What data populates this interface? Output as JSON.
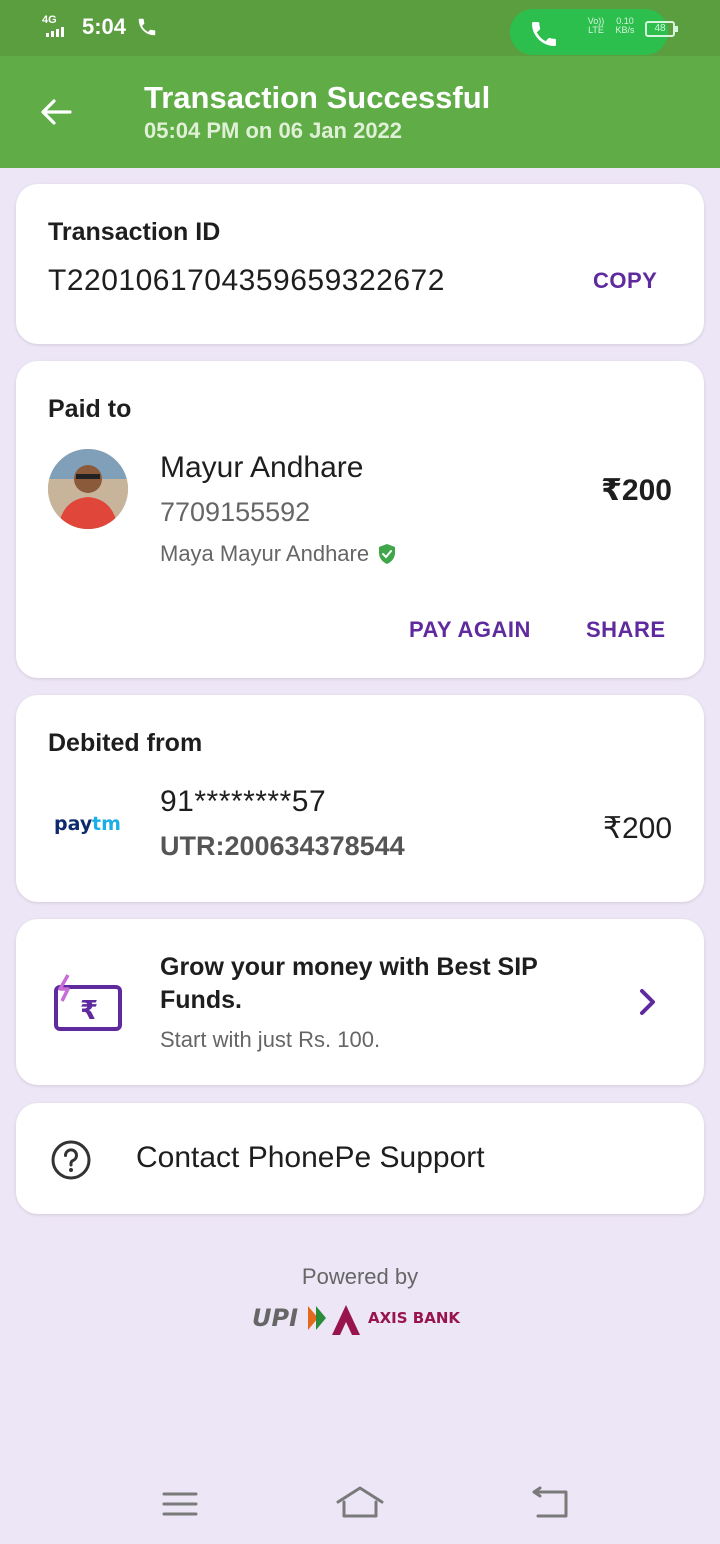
{
  "status_bar": {
    "network": "4G",
    "time": "5:04",
    "call_net": "Vo)) LTE",
    "speed": "0.10 KB/s",
    "battery": "48"
  },
  "header": {
    "title": "Transaction Successful",
    "subtitle": "05:04 PM on 06 Jan 2022",
    "background": "#60ad47"
  },
  "transaction": {
    "label": "Transaction ID",
    "id": "T2201061704359659322672",
    "copy_label": "COPY"
  },
  "paid_to": {
    "label": "Paid to",
    "name": "Mayur Andhare",
    "phone": "7709155592",
    "bank_name": "Maya Mayur Andhare",
    "amount": "₹200",
    "pay_again_label": "PAY AGAIN",
    "share_label": "SHARE"
  },
  "debited_from": {
    "label": "Debited from",
    "logo": "paytm",
    "account": "91********57",
    "utr": "UTR:200634378544",
    "amount": "₹200"
  },
  "promo": {
    "title": "Grow your money with Best SIP Funds.",
    "subtitle": "Start with just Rs. 100."
  },
  "support": {
    "label": "Contact PhonePe Support"
  },
  "footer": {
    "powered_by": "Powered by",
    "upi_logo": "UPI",
    "bank_logo": "AXIS BANK"
  },
  "accent_color": "#5f2a9e"
}
